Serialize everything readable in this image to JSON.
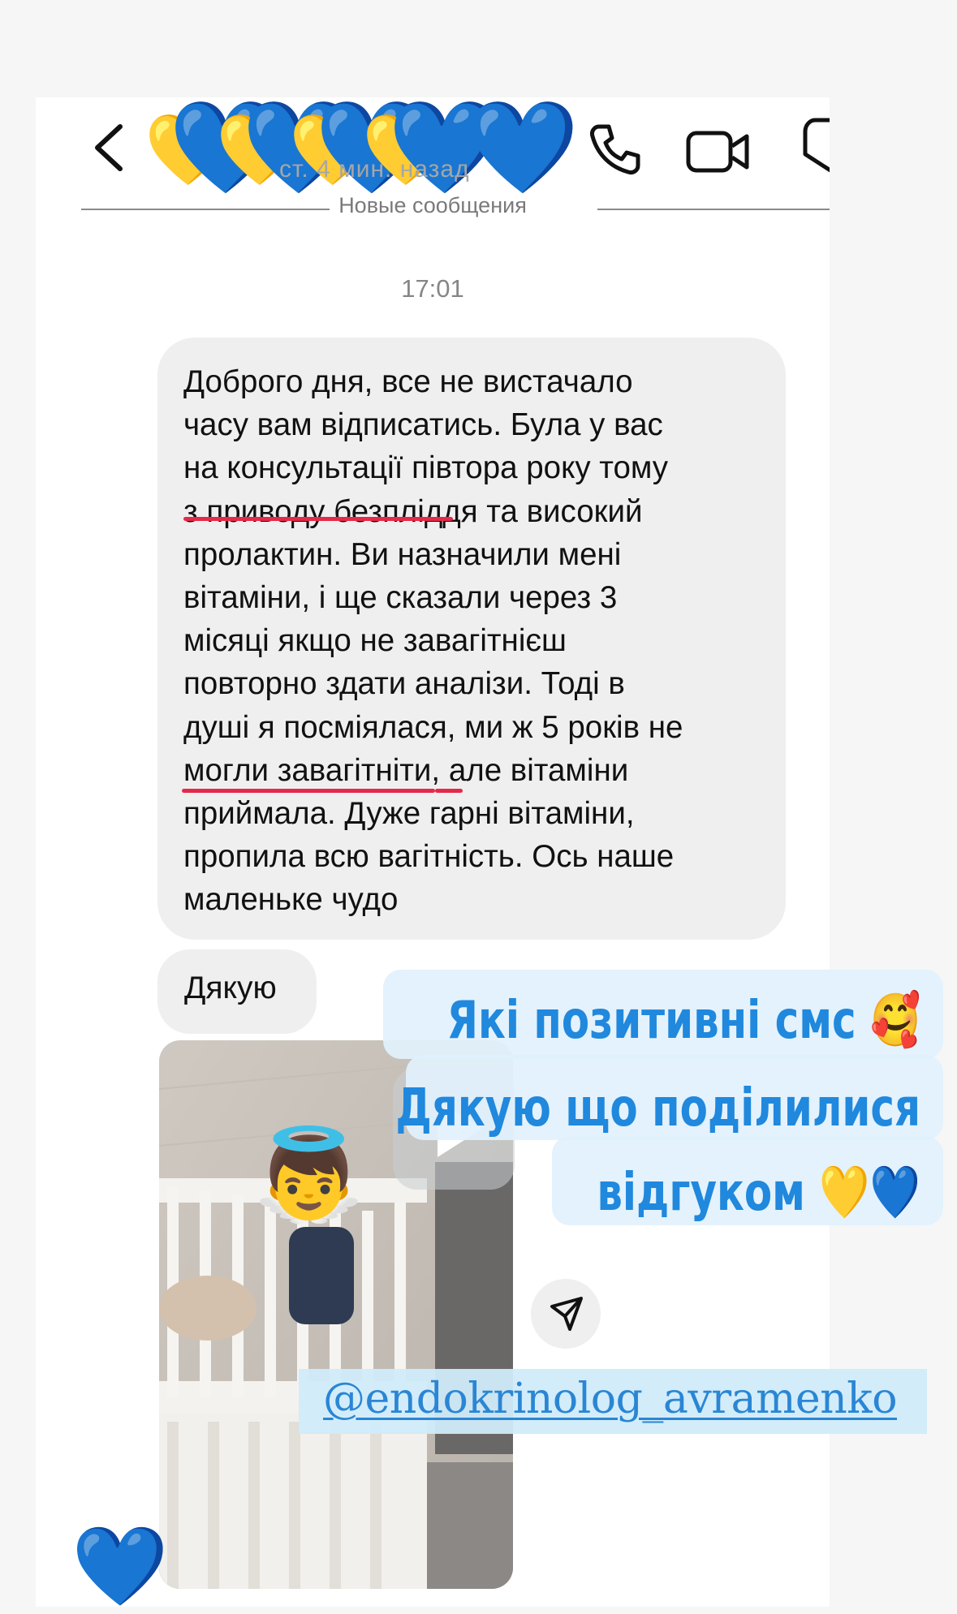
{
  "header": {
    "title_hearts": [
      "💛",
      "💙",
      "💛",
      "💙",
      "💛",
      "💙",
      "💛",
      "💙",
      "💙"
    ],
    "sub_status": "ст. 4 мин. назад",
    "icons": [
      "back-icon",
      "phone-icon",
      "video-icon",
      "flag-icon"
    ]
  },
  "divider": {
    "label": "Новые сообщения"
  },
  "timestamp": "17:01",
  "messages": [
    {
      "text": "Доброго дня, все не вистачало\nчасу вам відписатись. Була у вас\nна консультації півтора року тому\nз приводу безпліддя та високий\nпролактин. Ви назначили мені\nвітаміни, і ще сказали через 3\nмісяці якщо не завагітнієш\nповторно здати аналізи. Тоді в\nдуші я посміялася, ми ж 5 років не\nмогли завагітніти, але вітаміни\nприймала. Дуже гарні вітаміни,\nпропила всю вагітність. Ось наше\nмаленьке чудо"
    },
    {
      "text": "Дякую"
    }
  ],
  "media": {
    "type": "video",
    "sticker": "👼"
  },
  "reaction": "💙",
  "overlay": {
    "lines": [
      "Які позитивні смс 🥰",
      "Дякую що поділилися",
      "відгуком 💛💙"
    ],
    "mention": "@endokrinolog_avramenko"
  },
  "colors": {
    "accent_blue": "#2088dd",
    "underline_red": "#e5294a",
    "bubble": "#efefef"
  }
}
